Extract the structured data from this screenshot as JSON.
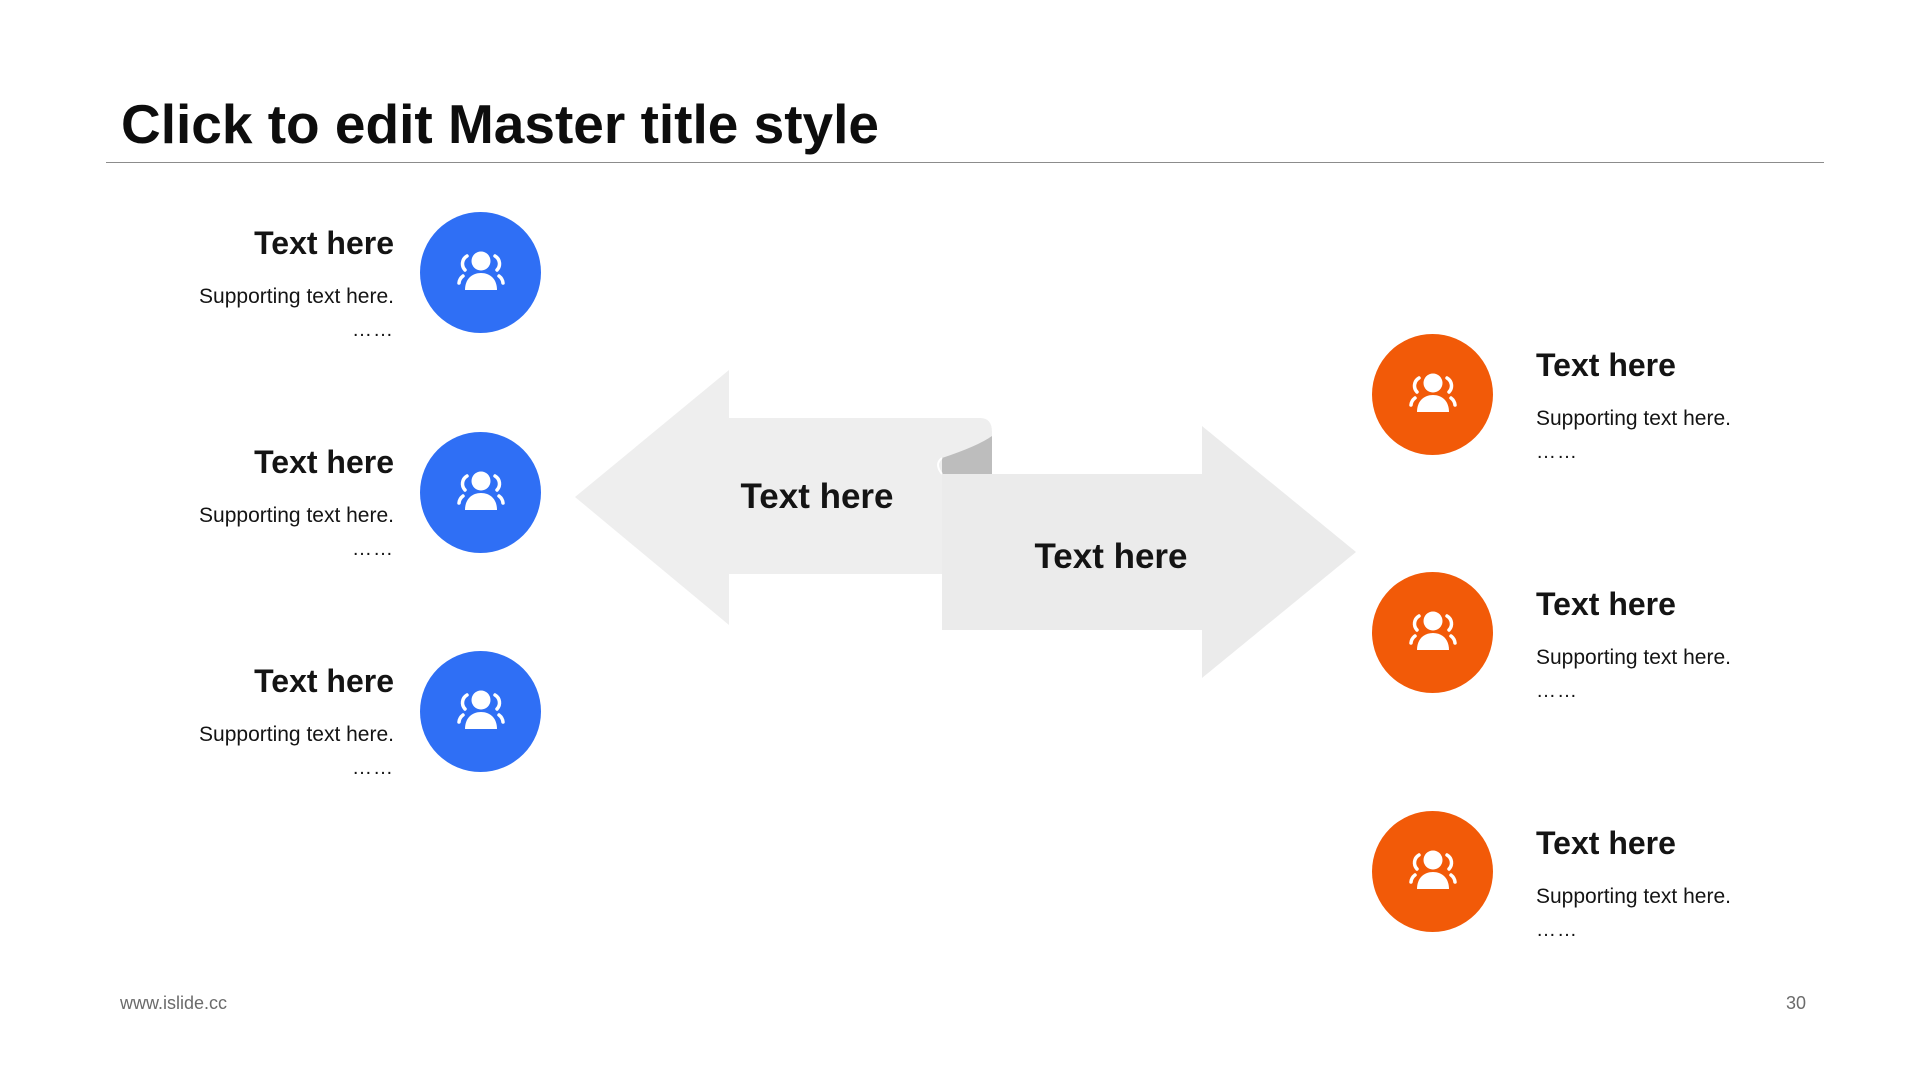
{
  "slide": {
    "title": "Click to edit Master title style",
    "footer_url": "www.islide.cc",
    "page_number": "30"
  },
  "colors": {
    "blue": "#2f6ff5",
    "orange": "#f25a08",
    "arrow_fill": "#eeeeee",
    "arrow_fold": "#bdbdbd"
  },
  "left_items": [
    {
      "heading": "Text here",
      "support": "Supporting text here.",
      "dots": "……",
      "icon": "users-icon"
    },
    {
      "heading": "Text here",
      "support": "Supporting text here.",
      "dots": "……",
      "icon": "users-icon"
    },
    {
      "heading": "Text here",
      "support": "Supporting text here.",
      "dots": "……",
      "icon": "users-icon"
    }
  ],
  "right_items": [
    {
      "heading": "Text here",
      "support": "Supporting text here.",
      "dots": "……",
      "icon": "users-icon"
    },
    {
      "heading": "Text here",
      "support": "Supporting text here.",
      "dots": "……",
      "icon": "users-icon"
    },
    {
      "heading": "Text here",
      "support": "Supporting text here.",
      "dots": "……",
      "icon": "users-icon"
    }
  ],
  "arrows": {
    "left_label": "Text here",
    "right_label": "Text here"
  }
}
